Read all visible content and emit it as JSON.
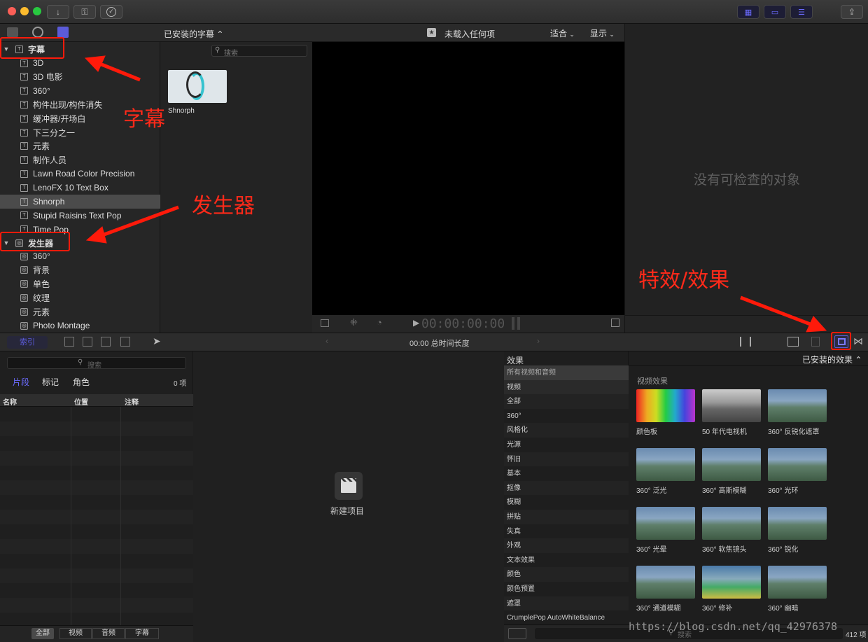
{
  "toolbar": {
    "download": "↓",
    "key": "⚿",
    "check": "✓",
    "share": "⇪"
  },
  "library": {
    "header_title": "已安装的字幕 ⌃",
    "search_placeholder": "搜索",
    "titles_section": "字幕",
    "titles_items": [
      "3D",
      "3D 电影",
      "360°",
      "构件出现/构件消失",
      "缓冲器/开场白",
      "下三分之一",
      "元素",
      "制作人员",
      "Lawn Road Color Precision",
      "LenoFX 10 Text Box",
      "Shnorph",
      "Stupid Raisins Text Pop",
      "Time Pop"
    ],
    "selected_item": "Shnorph",
    "generators_section": "发生器",
    "generators_items": [
      "360°",
      "背景",
      "单色",
      "纹理",
      "元素",
      "Photo Montage"
    ],
    "clip_name": "Shnorph"
  },
  "viewer": {
    "status": "未载入任何项",
    "fit": "适合",
    "display": "显示",
    "timecode": "00:00:00:00"
  },
  "inspector": {
    "empty_text": "没有可检查的对象"
  },
  "timeline_toolbar": {
    "index_label": "索引",
    "duration": "00:00 总时间长度"
  },
  "index": {
    "search_placeholder": "搜索",
    "tabs": [
      "片段",
      "标记",
      "角色"
    ],
    "count": "0 项",
    "columns": [
      "名称",
      "位置",
      "注释"
    ],
    "bottom_tabs": [
      "全部",
      "视频",
      "音频",
      "字幕"
    ]
  },
  "timeline": {
    "new_project": "新建项目"
  },
  "effects": {
    "header": "效果",
    "installed": "已安装的效果 ⌃",
    "section_label": "视频效果",
    "categories": [
      "所有视频和音频",
      "视频",
      "全部",
      "360°",
      "风格化",
      "光源",
      "怀旧",
      "基本",
      "抠像",
      "模糊",
      "拼贴",
      "失真",
      "外观",
      "文本效果",
      "颜色",
      "颜色预置",
      "遮罩",
      "CrumplePop AutoWhiteBalance"
    ],
    "items": [
      "颜色板",
      "50 年代电视机",
      "360° 反锐化遮罩",
      "360° 泛光",
      "360° 高斯模糊",
      "360° 光环",
      "360° 光晕",
      "360° 软焦镜头",
      "360° 锐化",
      "360° 通道模糊",
      "360° 修补",
      "360° 幽暗"
    ],
    "count": "412 项",
    "search_placeholder": "搜索"
  },
  "annotations": {
    "titles": "字幕",
    "generators": "发生器",
    "effects": "特效/效果"
  },
  "watermark": "https://blog.csdn.net/qq_42976378"
}
